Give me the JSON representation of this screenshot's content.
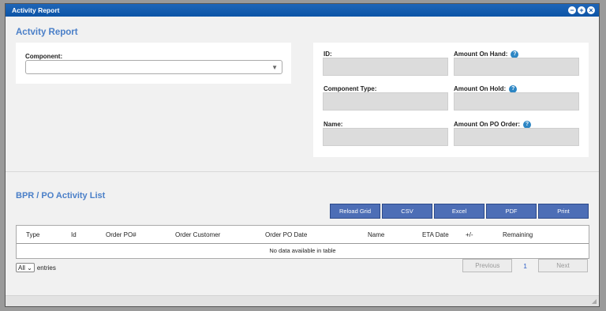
{
  "window": {
    "title": "Activity Report",
    "buttons": [
      "minimize-icon",
      "add-icon",
      "close-icon"
    ]
  },
  "page": {
    "title": "Actvity Report"
  },
  "component_card": {
    "component_label": "Component:",
    "component_value": ""
  },
  "details_card": {
    "id_label": "ID:",
    "component_type_label": "Component Type:",
    "name_label": "Name:",
    "amount_on_hand_label": "Amount On Hand:",
    "amount_on_hold_label": "Amount On Hold:",
    "amount_on_po_order_label": "Amount On PO Order:",
    "id_value": "",
    "component_type_value": "",
    "name_value": "",
    "amount_on_hand_value": "",
    "amount_on_hold_value": "",
    "amount_on_po_order_value": ""
  },
  "activity": {
    "title": "BPR / PO Activity List",
    "buttons": [
      "Reload Grid",
      "CSV",
      "Excel",
      "PDF",
      "Print"
    ],
    "columns": [
      "Type",
      "Id",
      "Order PO#",
      "Order Customer",
      "Order PO Date",
      "Name",
      "ETA Date",
      "+/-",
      "Remaining"
    ],
    "empty_message": "No data available in table",
    "entries_select": "All",
    "entries_label": "entries",
    "previous_label": "Previous",
    "page_number": "1",
    "next_label": "Next"
  },
  "colors": {
    "titlebar": "#0c54a6",
    "heading": "#4a7fc8",
    "button": "#4d6eb6",
    "help_icon": "#2d86c4"
  }
}
